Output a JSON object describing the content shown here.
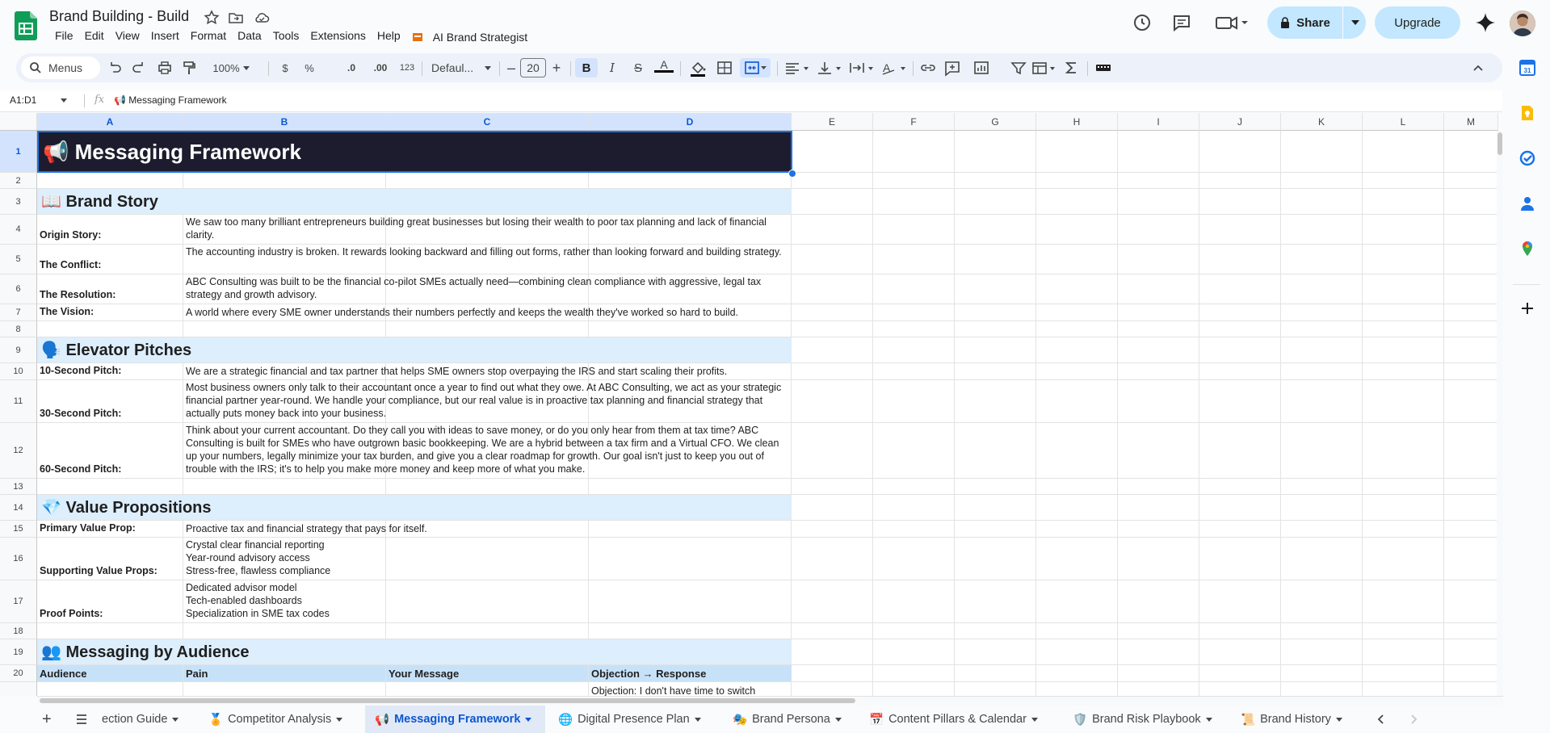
{
  "doc": {
    "title": "Brand Building - Build",
    "menu": [
      "File",
      "Edit",
      "View",
      "Insert",
      "Format",
      "Data",
      "Tools",
      "Extensions",
      "Help"
    ],
    "ai_menu": "AI Brand Strategist"
  },
  "header": {
    "share_label": "Share",
    "upgrade_label": "Upgrade"
  },
  "toolbar": {
    "search_label": "Menus",
    "zoom": "100%",
    "currency": "$",
    "percent": "%",
    "dec_decrease": ".0",
    "dec_increase": ".00",
    "num_format": "123",
    "font": "Defaul...",
    "font_size": "20",
    "bold": "B",
    "italic": "I",
    "strike": "S",
    "text_color": "A"
  },
  "formula_bar": {
    "name_box": "A1:D1",
    "fx": "fx",
    "content": "📢 Messaging Framework"
  },
  "columns": [
    "A",
    "B",
    "C",
    "D",
    "E",
    "F",
    "G",
    "H",
    "I",
    "J",
    "K",
    "L",
    "M"
  ],
  "rows": [
    "1",
    "2",
    "3",
    "4",
    "5",
    "6",
    "7",
    "8",
    "9",
    "10",
    "11",
    "12",
    "13",
    "14",
    "15",
    "16",
    "17",
    "18",
    "19",
    "20"
  ],
  "sheet": {
    "title": "📢 Messaging Framework",
    "brand_story": {
      "heading": "📖 Brand Story",
      "items": [
        {
          "label": "Origin Story:",
          "value": "We saw too many brilliant entrepreneurs building great businesses but losing their wealth to poor tax planning and lack of financial clarity."
        },
        {
          "label": "The Conflict:",
          "value": "The accounting industry is broken. It rewards looking backward and filling out forms, rather than looking forward and building strategy."
        },
        {
          "label": "The Resolution:",
          "value": "ABC Consulting was built to be the financial co-pilot SMEs actually need—combining clean compliance with aggressive, legal tax strategy and growth advisory."
        },
        {
          "label": "The Vision:",
          "value": "A world where every SME owner understands their numbers perfectly and keeps the wealth they've worked so hard to build."
        }
      ]
    },
    "elevator": {
      "heading": "🗣️ Elevator Pitches",
      "items": [
        {
          "label": "10-Second Pitch:",
          "value": "We are a strategic financial and tax partner that helps SME owners stop overpaying the IRS and start scaling their profits."
        },
        {
          "label": "30-Second Pitch:",
          "value": "Most business owners only talk to their accountant once a year to find out what they owe. At ABC Consulting, we act as your strategic financial partner year-round. We handle your compliance, but our real value is in proactive tax planning and financial strategy that actually puts money back into your business."
        },
        {
          "label": "60-Second Pitch:",
          "value": "Think about your current accountant. Do they call you with ideas to save money, or do you only hear from them at tax time? ABC Consulting is built for SMEs who have outgrown basic bookkeeping. We are a hybrid between a tax firm and a Virtual CFO. We clean up your numbers, legally minimize your tax burden, and give you a clear roadmap for growth. Our goal isn't just to keep you out of trouble with the IRS; it's to help you make more money and keep more of what you make."
        }
      ]
    },
    "value_props": {
      "heading": "💎 Value Propositions",
      "items": [
        {
          "label": "Primary Value Prop:",
          "value": "Proactive tax and financial strategy that pays for itself."
        },
        {
          "label": "Supporting Value Props:",
          "value": "Crystal clear financial reporting\nYear-round advisory access\nStress-free, flawless compliance"
        },
        {
          "label": "Proof Points:",
          "value": "Dedicated advisor model\nTech-enabled dashboards\nSpecialization in SME tax codes"
        }
      ]
    },
    "audience": {
      "heading": "👥 Messaging by Audience",
      "columns": [
        "Audience",
        "Pain",
        "Your Message",
        "Objection → Response"
      ],
      "partial_row": "Objection: I don't have time to switch"
    }
  },
  "tabs": [
    {
      "label": "ection Guide",
      "icon": ""
    },
    {
      "label": "Competitor Analysis",
      "icon": "🏅"
    },
    {
      "label": "Messaging Framework",
      "icon": "📢"
    },
    {
      "label": "Digital Presence Plan",
      "icon": "🌐"
    },
    {
      "label": "Brand Persona",
      "icon": "🎭"
    },
    {
      "label": "Content Pillars & Calendar",
      "icon": "📅"
    },
    {
      "label": "Brand Risk Playbook",
      "icon": "🛡️"
    },
    {
      "label": "Brand History",
      "icon": "📜"
    }
  ],
  "colors": {
    "accent": "#0b57d0",
    "title_bg": "#1c1c2e",
    "section_bg": "#ddeefd",
    "table_header_bg": "#c7e2f8",
    "share_bg": "#c2e7ff"
  },
  "icons": [
    "sheets-logo-icon",
    "star-icon",
    "folder-move-icon",
    "cloud-status-icon",
    "history-icon",
    "comment-icon",
    "meet-icon",
    "lock-icon",
    "gemini-icon",
    "search-icon",
    "undo-icon",
    "redo-icon",
    "print-icon",
    "paint-format-icon",
    "fill-color-icon",
    "borders-icon",
    "merge-icon",
    "align-icon",
    "link-icon",
    "filter-icon",
    "function-icon",
    "calendar-icon",
    "keep-icon",
    "tasks-icon",
    "contacts-icon",
    "maps-icon",
    "add-icon"
  ]
}
